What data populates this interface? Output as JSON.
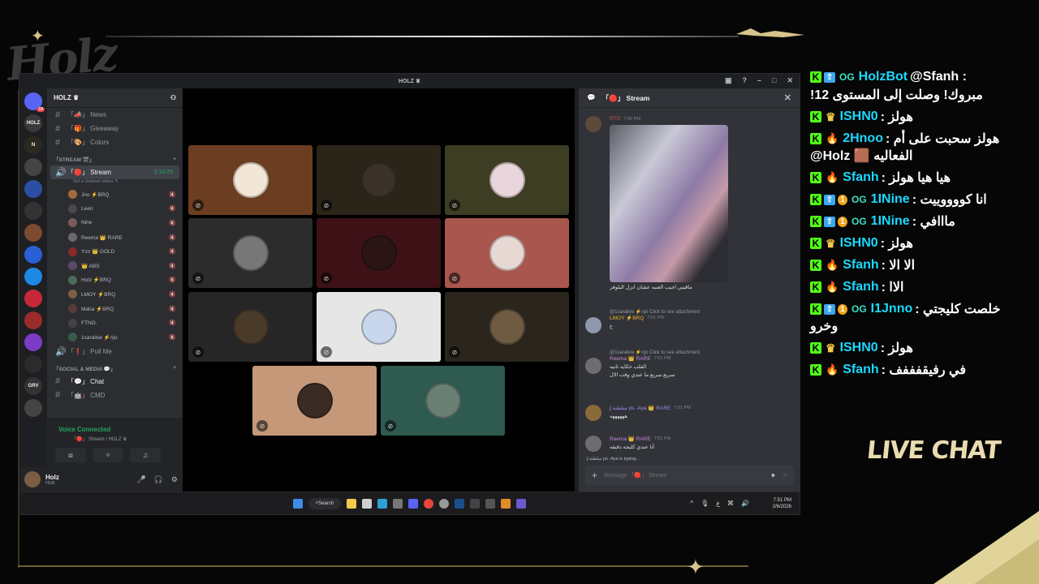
{
  "overlay": {
    "brand": "Holz",
    "live_chat_label": "LIVE CHAT"
  },
  "window": {
    "title": "HOLZ ♛",
    "controls": [
      "▣",
      "?",
      "–",
      "□",
      "✕"
    ]
  },
  "guilds": [
    {
      "label": "",
      "ping": "19"
    },
    {
      "label": "HOLZ",
      "ping": ""
    },
    {
      "label": "N",
      "ping": ""
    },
    {
      "label": "",
      "ping": ""
    },
    {
      "label": "",
      "ping": ""
    },
    {
      "label": "",
      "ping": ""
    },
    {
      "label": "",
      "ping": ""
    },
    {
      "label": "",
      "ping": ""
    },
    {
      "label": "",
      "ping": ""
    },
    {
      "label": "",
      "ping": ""
    },
    {
      "label": "",
      "ping": ""
    },
    {
      "label": "",
      "ping": ""
    },
    {
      "label": "",
      "ping": ""
    },
    {
      "label": "GRV",
      "ping": ""
    },
    {
      "label": "",
      "ping": ""
    }
  ],
  "server": {
    "name": "HOLZ ♛",
    "channels_top": [
      {
        "label": "「📣」 News"
      },
      {
        "label": "「🎁」 Giveaway"
      },
      {
        "label": "「🎨」 Colors"
      }
    ],
    "stream_category": "「STREAM 🎬」",
    "stream_channel": {
      "label": "「🔴」 Stream",
      "timer": "3:16:25",
      "status": "Set a channel status ✎"
    },
    "voice_users": [
      {
        "name": "Jno ⚡BRQ"
      },
      {
        "name": "Leen"
      },
      {
        "name": "Nine"
      },
      {
        "name": "Reema 👑 RARE"
      },
      {
        "name": "Yzn 👑 GOLD"
      },
      {
        "name": "👑 ABS"
      },
      {
        "name": "Holz ⚡BRQ"
      },
      {
        "name": "LMOY ⚡BRQ"
      },
      {
        "name": "Maha ⚡BRQ"
      },
      {
        "name": "FTNO."
      },
      {
        "name": "1saralive ⚡njo"
      }
    ],
    "pull_channel": "「❗」 Pull Me",
    "social_category": "「SOCIAL & MEDIA 💬」",
    "chat_channel": "「💬」 Chat",
    "cmd_channel": "「🤖」 CMD"
  },
  "voice": {
    "title": "Voice Connected",
    "sub": "「🔴」 Stream / HOLZ ♛",
    "buttons": [
      "⧈",
      "✧",
      "♫"
    ]
  },
  "user": {
    "name": "Holz",
    "tag": "Holz",
    "controls": [
      "🎤",
      "🎧",
      "⚙"
    ]
  },
  "tiles": [
    {
      "bg": "#6b3e22",
      "av": "#f2e6d8"
    },
    {
      "bg": "#2b2519",
      "av": "#3a3128"
    },
    {
      "bg": "#3c3d23",
      "av": "#e9d6dc"
    },
    {
      "bg": "#2c2c2c",
      "av": "#777777"
    },
    {
      "bg": "#3d1116",
      "av": "#2a1416"
    },
    {
      "bg": "#a9564e",
      "av": "#e8d8d4"
    },
    {
      "bg": "#262626",
      "av": "#4a3a2a"
    },
    {
      "bg": "#e6e6e6",
      "av": "#c8d7ec"
    },
    {
      "bg": "#2a261d",
      "av": "#6e5b42"
    },
    {
      "bg": "#c6987a",
      "av": "#3b2b25"
    },
    {
      "bg": "#2e5a50",
      "av": "#6a7f74"
    }
  ],
  "thread": {
    "title": "「🔴」 Stream",
    "messages": [
      {
        "author": "RTO",
        "time": "7:50 PM",
        "text": "ماقيني اجيب العنبه عشان انزل البلوفر"
      },
      {
        "author": "LMOY ⚡BRQ",
        "reply": "@1saralive ⚡njo Click to see attachment",
        "time": "7:51 PM",
        "text": "ع"
      },
      {
        "author": "Reema 👑 RARE",
        "reply": "@1saralive ⚡njo Click to see attachment",
        "time": "7:51 PM",
        "text": "القلب حكايه ثانيه",
        "text2": "سريع سريع ما عندي وقت الال"
      },
      {
        "author": "ʄ سلطنة ps -Aya 👑 RARE",
        "time": "7:51 PM",
        "text": "ههههههه"
      },
      {
        "author": "Reema 👑 RARE",
        "time": "7:51 PM",
        "text": "أنا عندي كليجه دقيقه"
      }
    ],
    "typing": "ʄ سلطنة ps -Aya is typing...",
    "composer_placeholder": "Message 「🔴」 Stream"
  },
  "taskbar": {
    "search": "Search",
    "time": "7:51 PM",
    "date": "2/6/2026",
    "lang": "ع"
  },
  "chat_lines": [
    {
      "badges": [
        "lvl",
        "og"
      ],
      "name": "HolzBot",
      "msg": "@Sfanh :",
      "wrap": "!مبروك! وصلت إلى المستوى 12"
    },
    {
      "badges": [
        "crown"
      ],
      "name": "ISHN0",
      "msg": ": هولز"
    },
    {
      "badges": [
        "fire"
      ],
      "name": "2Hnoo",
      "msg": ": هولز سحبت على أم",
      "wrap": "@Holz 🟫 الفعاليه"
    },
    {
      "badges": [
        "fire"
      ],
      "name": "Sfanh",
      "msg": ": هيا هيا هولز"
    },
    {
      "badges": [
        "lvl",
        "sub",
        "og"
      ],
      "name": "1INine",
      "msg": ": انا كووووييت"
    },
    {
      "badges": [
        "lvl",
        "sub",
        "og"
      ],
      "name": "1INine",
      "msg": ": مااافي"
    },
    {
      "badges": [
        "crown"
      ],
      "name": "ISHN0",
      "msg": ": هولز"
    },
    {
      "badges": [
        "fire"
      ],
      "name": "Sfanh",
      "msg": ": الا الا"
    },
    {
      "badges": [
        "fire"
      ],
      "name": "Sfanh",
      "msg": ": الاا"
    },
    {
      "badges": [
        "lvl",
        "sub",
        "og"
      ],
      "name": "I1Jnno",
      "msg": ": خلصت كليجتي",
      "wrap": "وخرو"
    },
    {
      "badges": [
        "crown"
      ],
      "name": "ISHN0",
      "msg": ": هولز"
    },
    {
      "badges": [
        "fire"
      ],
      "name": "Sfanh",
      "msg": ": في رفيقفففف"
    }
  ]
}
